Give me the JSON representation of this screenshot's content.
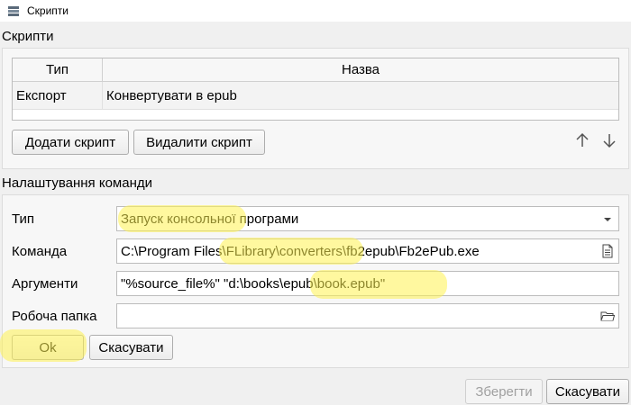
{
  "window": {
    "title": "Скрипти"
  },
  "scripts_section": {
    "label": "Скрипти",
    "table": {
      "columns": [
        "Тип",
        "Назва"
      ],
      "rows": [
        {
          "type": "Експорт",
          "name": "Конвертувати в epub"
        }
      ]
    },
    "add_button": "Додати скрипт",
    "delete_button": "Видалити скрипт"
  },
  "command_section": {
    "label": "Налаштування команди",
    "type_label": "Тип",
    "type_value": "Запуск консольної програми",
    "command_label": "Команда",
    "command_value": "C:\\Program Files\\FLibrary\\converters\\fb2epub\\Fb2ePub.exe",
    "arguments_label": "Аргументи",
    "arguments_value": "\"%source_file%\" \"d:\\books\\epub\\book.epub\"",
    "workdir_label": "Робоча папка",
    "workdir_value": "",
    "ok_button": "Ok",
    "cancel_button": "Скасувати"
  },
  "footer": {
    "save_button": "Зберегти",
    "cancel_button": "Скасувати"
  },
  "icons": {
    "app": "app-stack-icon",
    "move_up": "arrow-up-icon",
    "move_down": "arrow-down-icon",
    "dropdown": "chevron-down-icon",
    "file_browse": "file-icon",
    "folder_browse": "folder-icon"
  },
  "colors": {
    "highlight": "#fff250"
  }
}
